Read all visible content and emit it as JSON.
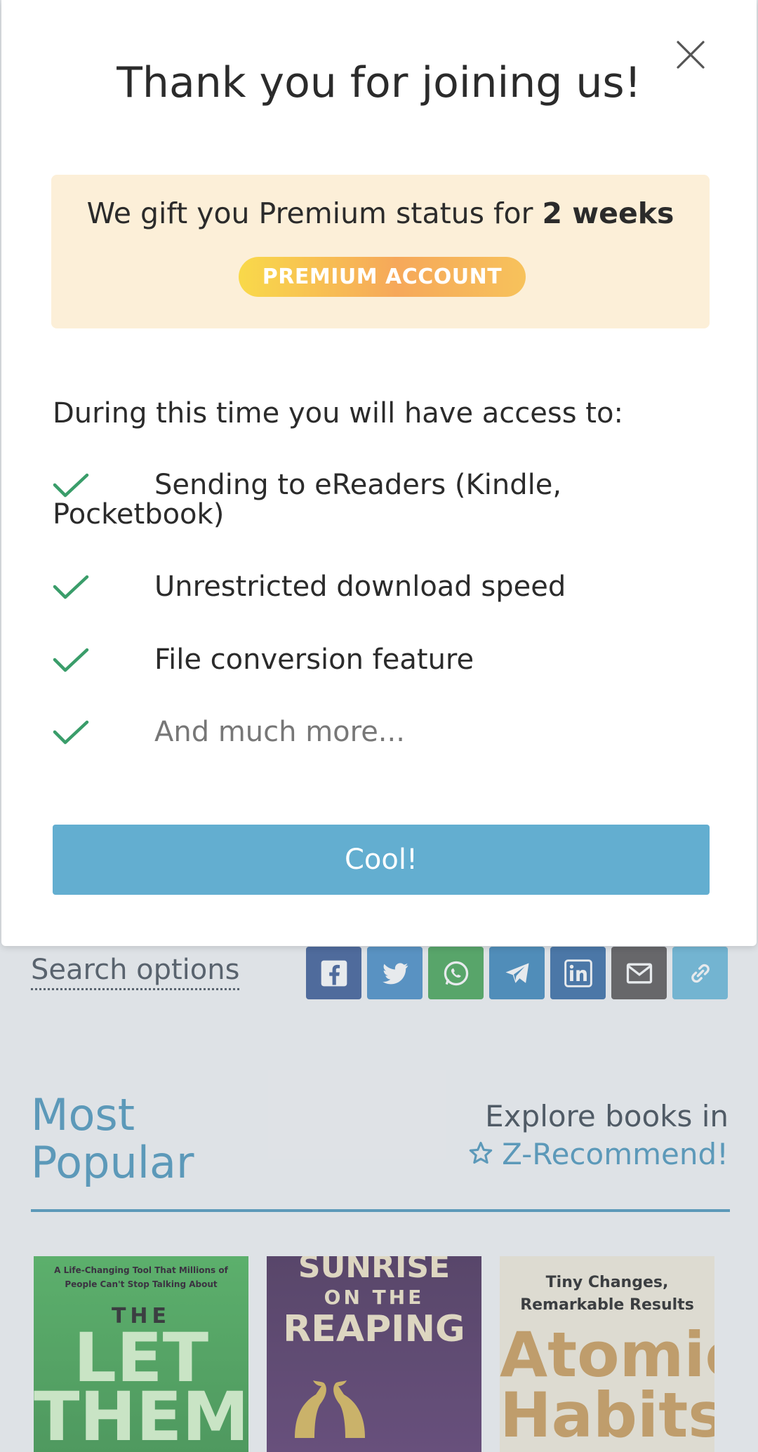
{
  "modal": {
    "title": "Thank you for joining us!",
    "gift_text_prefix": "We gift you Premium status for ",
    "gift_text_bold": "2 weeks",
    "premium_badge": "PREMIUM ACCOUNT",
    "access_heading": "During this time you will have access to:",
    "features": [
      "Sending to eReaders (Kindle, Pocketbook)",
      "Unrestricted download speed",
      "File conversion feature",
      "And much more..."
    ],
    "cool_button": "Cool!"
  },
  "background": {
    "search_options": "Search options",
    "share_buttons": [
      {
        "icon": "facebook-icon",
        "color": "#2d4f8f"
      },
      {
        "icon": "twitter-icon",
        "color": "#3b86c4"
      },
      {
        "icon": "whatsapp-icon",
        "color": "#3aa04a"
      },
      {
        "icon": "telegram-icon",
        "color": "#2f7fb8"
      },
      {
        "icon": "linkedin-icon",
        "color": "#27609e"
      },
      {
        "icon": "email-icon",
        "color": "#4e4a4a"
      },
      {
        "icon": "link-icon",
        "color": "#5fb4d8"
      }
    ],
    "most_popular": "Most Popular",
    "explore_line1": "Explore books in",
    "explore_line2": "Z-Recommend!",
    "books": [
      {
        "tagline": "A Life-Changing Tool That Millions of People Can't Stop Talking About",
        "the": "THE",
        "title": "LET THEM"
      },
      {
        "title_top": "SUNRISE",
        "on_the": "ON THE",
        "title_bottom": "REAPING"
      },
      {
        "subtitle": "Tiny Changes, Remarkable Results",
        "title": "Atomic Habits"
      }
    ]
  }
}
